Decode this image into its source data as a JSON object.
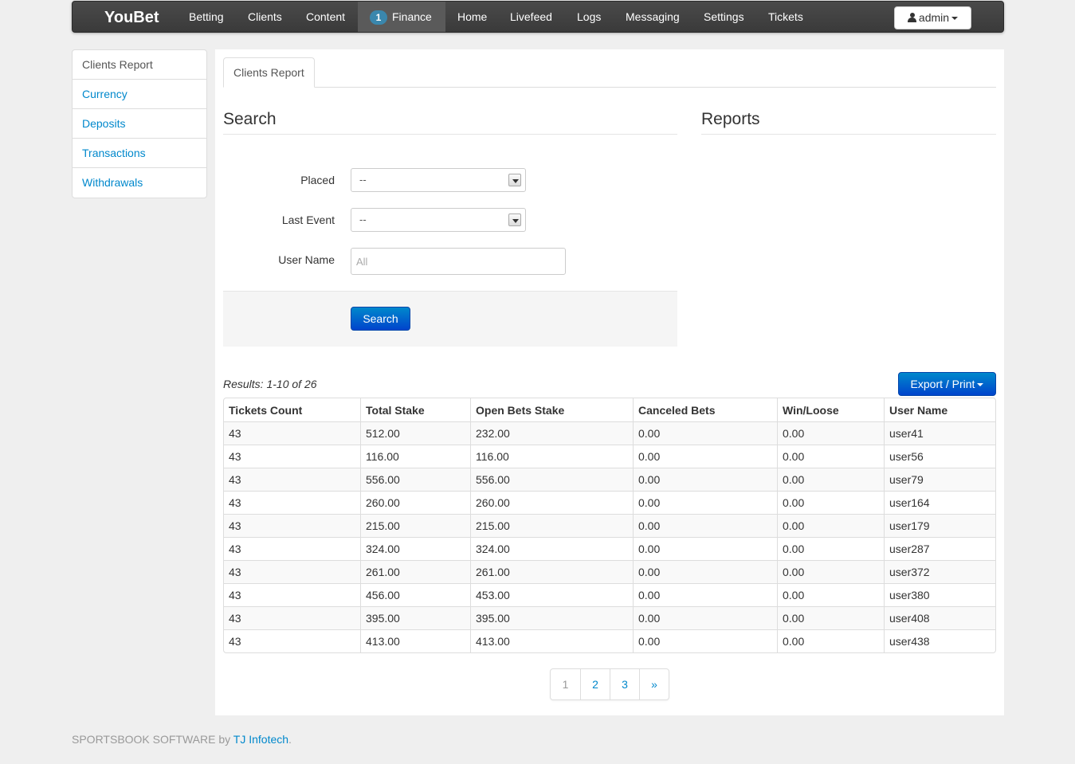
{
  "navbar": {
    "brand": "YouBet",
    "items": [
      {
        "label": "Betting"
      },
      {
        "label": "Clients"
      },
      {
        "label": "Content"
      },
      {
        "label": "Finance",
        "badge": "1",
        "active": true
      },
      {
        "label": "Home"
      },
      {
        "label": "Livefeed"
      },
      {
        "label": "Logs"
      },
      {
        "label": "Messaging"
      },
      {
        "label": "Settings"
      },
      {
        "label": "Tickets"
      }
    ],
    "user_label": "admin"
  },
  "sidebar": {
    "items": [
      {
        "label": "Clients Report",
        "active": true
      },
      {
        "label": "Currency"
      },
      {
        "label": "Deposits"
      },
      {
        "label": "Transactions"
      },
      {
        "label": "Withdrawals"
      }
    ]
  },
  "tab": {
    "label": "Clients Report"
  },
  "search": {
    "title": "Search",
    "placed_label": "Placed",
    "placed_value": "--",
    "last_event_label": "Last Event",
    "last_event_value": "--",
    "username_label": "User Name",
    "username_placeholder": "All",
    "button_label": "Search"
  },
  "reports": {
    "title": "Reports"
  },
  "results": {
    "summary": "Results: 1-10 of 26",
    "export_label": "Export / Print"
  },
  "table": {
    "columns": [
      "Tickets Count",
      "Total Stake",
      "Open Bets Stake",
      "Canceled Bets",
      "Win/Loose",
      "User Name"
    ],
    "rows": [
      [
        "43",
        "512.00",
        "232.00",
        "0.00",
        "0.00",
        "user41"
      ],
      [
        "43",
        "116.00",
        "116.00",
        "0.00",
        "0.00",
        "user56"
      ],
      [
        "43",
        "556.00",
        "556.00",
        "0.00",
        "0.00",
        "user79"
      ],
      [
        "43",
        "260.00",
        "260.00",
        "0.00",
        "0.00",
        "user164"
      ],
      [
        "43",
        "215.00",
        "215.00",
        "0.00",
        "0.00",
        "user179"
      ],
      [
        "43",
        "324.00",
        "324.00",
        "0.00",
        "0.00",
        "user287"
      ],
      [
        "43",
        "261.00",
        "261.00",
        "0.00",
        "0.00",
        "user372"
      ],
      [
        "43",
        "456.00",
        "453.00",
        "0.00",
        "0.00",
        "user380"
      ],
      [
        "43",
        "395.00",
        "395.00",
        "0.00",
        "0.00",
        "user408"
      ],
      [
        "43",
        "413.00",
        "413.00",
        "0.00",
        "0.00",
        "user438"
      ]
    ]
  },
  "pagination": [
    "1",
    "2",
    "3",
    "»"
  ],
  "footer": {
    "text": "SPORTSBOOK SOFTWARE by ",
    "link": "TJ Infotech",
    "end": "."
  }
}
